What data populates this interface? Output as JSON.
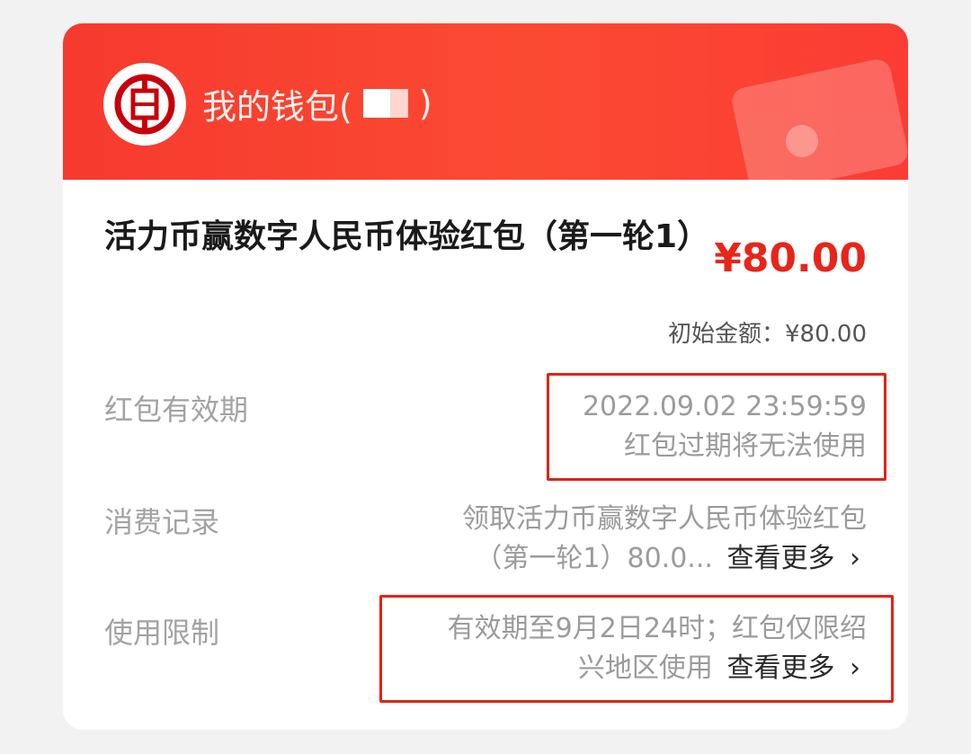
{
  "header": {
    "title_prefix": "我的钱包(",
    "title_suffix": ")",
    "brand_color": "#f63a2e"
  },
  "packet": {
    "title": "活力币赢数字人民币体验红包（第一轮1）",
    "amount": "¥80.00",
    "initial_amount": "初始金额：¥80.00"
  },
  "rows": {
    "validity": {
      "label": "红包有效期",
      "line1": "2022.09.02 23:59:59",
      "line2": "红包过期将无法使用"
    },
    "records": {
      "label": "消费记录",
      "line1": "领取活力币赢数字人民币体验红包",
      "line2": "（第一轮1）80.0...",
      "more": "查看更多"
    },
    "limits": {
      "label": "使用限制",
      "line1": "有效期至9月2日24时；红包仅限绍",
      "line2": "兴地区使用",
      "more": "查看更多"
    }
  },
  "icons": {
    "bank_logo": "icbc-logo-icon",
    "envelope": "envelope-icon",
    "chevron": "chevron-right-icon"
  },
  "accent_colors": {
    "amount": "#e8251a",
    "highlight_box": "#e52213"
  }
}
